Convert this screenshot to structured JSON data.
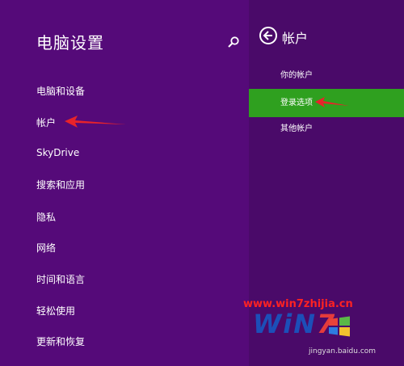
{
  "left": {
    "title": "电脑设置",
    "items": [
      "电脑和设备",
      "帐户",
      "SkyDrive",
      "搜索和应用",
      "隐私",
      "网络",
      "时间和语言",
      "轻松使用",
      "更新和恢复"
    ]
  },
  "right": {
    "title": "帐户",
    "items": [
      "你的帐户",
      "登录选项",
      "其他帐户"
    ],
    "selected_index": 1
  },
  "watermark": {
    "url": "www.win7zhijia.cn",
    "logo_text": "WiN",
    "logo_z": "7",
    "small": "jingyan.baidu.com"
  },
  "colors": {
    "left_bg": "#550a79",
    "right_bg": "#4a0a69",
    "selected_bg": "#2fa01f",
    "arrow": "#e8232a"
  },
  "icons": [
    "search-icon",
    "back-arrow-icon",
    "windows-logo-icon"
  ]
}
